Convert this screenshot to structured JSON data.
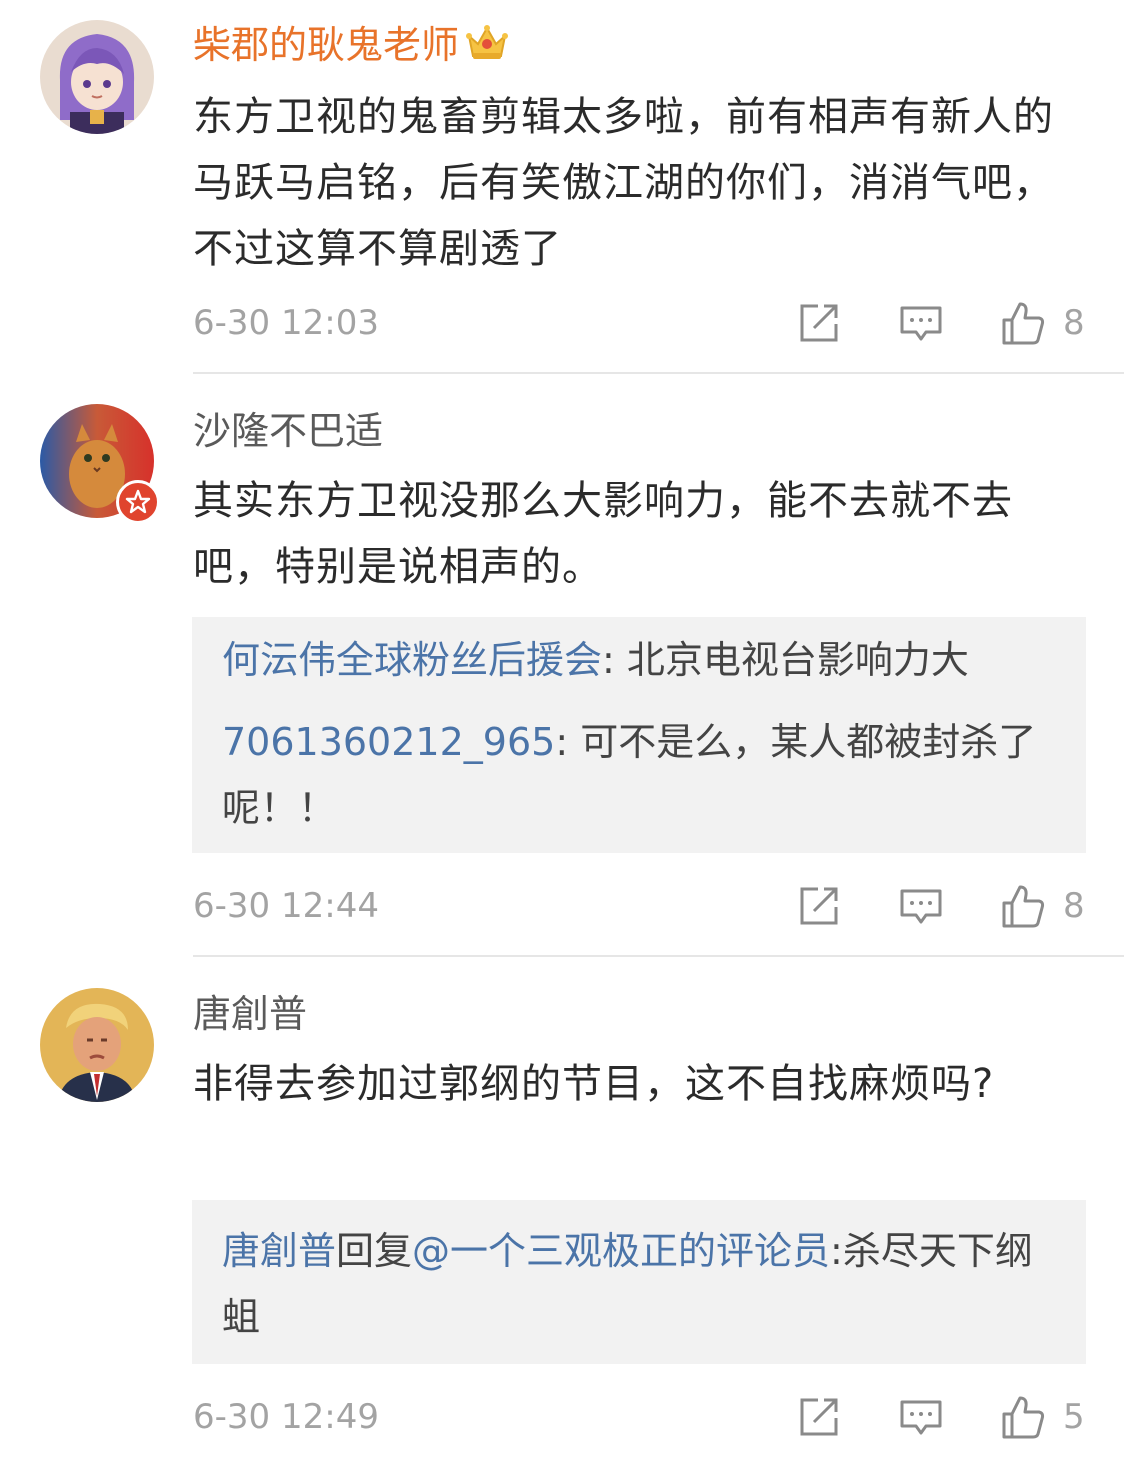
{
  "comments": [
    {
      "username": "柴郡的耿鬼老师",
      "text": "东方卫视的鬼畜剪辑太多啦，前有相声有新人的马跃马启铭，后有笑傲江湖的你们，消消气吧，不过这算不算剧透了",
      "timestamp": "6-30 12:03",
      "likes": "8"
    },
    {
      "username": "沙隆不巴适",
      "text": "其实东方卫视没那么大影响力，能不去就不去吧，特别是说相声的。",
      "replies": [
        {
          "user": "何沄伟全球粉丝后援会",
          "sep": ": ",
          "text": "北京电视台影响力大"
        },
        {
          "user": "7061360212_965",
          "sep": ": ",
          "text": "可不是么，某人都被封杀了呢！！"
        }
      ],
      "timestamp": "6-30 12:44",
      "likes": "8"
    },
    {
      "username": "唐創普",
      "text": "非得去参加过郭纲的节目，这不自找麻烦吗?",
      "replies": [
        {
          "user": "唐創普",
          "mid": "回复",
          "mention": "@一个三观极正的评论员",
          "sep": ":",
          "text": "杀尽天下纲蛆"
        }
      ],
      "timestamp": "6-30 12:49",
      "likes": "5"
    }
  ],
  "icons": [
    "crown-icon",
    "share-icon",
    "comment-icon",
    "like-icon",
    "verified-badge-icon"
  ],
  "colors": {
    "vip_name": "#e8732a",
    "link": "#4b74a8",
    "meta": "#a3a3a3",
    "reply_bg": "#f2f2f2"
  }
}
